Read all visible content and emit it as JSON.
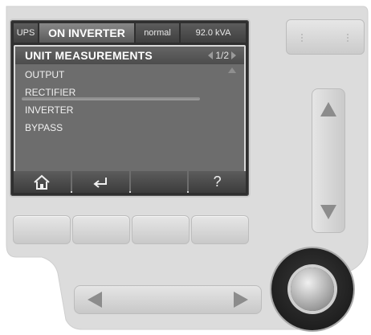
{
  "status_bar": {
    "ups": "UPS",
    "mode": "ON INVERTER",
    "state": "normal",
    "power": "92.0 kVA"
  },
  "menu": {
    "title": "UNIT MEASUREMENTS",
    "page": "1/2",
    "items": [
      {
        "label": "OUTPUT",
        "selected": false
      },
      {
        "label": "RECTIFIER",
        "selected": true
      },
      {
        "label": "INVERTER",
        "selected": false
      },
      {
        "label": "BYPASS",
        "selected": false
      }
    ]
  },
  "softkeys": {
    "home_icon": "home-icon",
    "back_icon": "return-arrow-icon",
    "blank": "",
    "help": "?"
  },
  "colors": {
    "panel": "#dcdcdc",
    "screen_bg": "#6d6d6d",
    "screen_text": "#f0f0f0"
  }
}
